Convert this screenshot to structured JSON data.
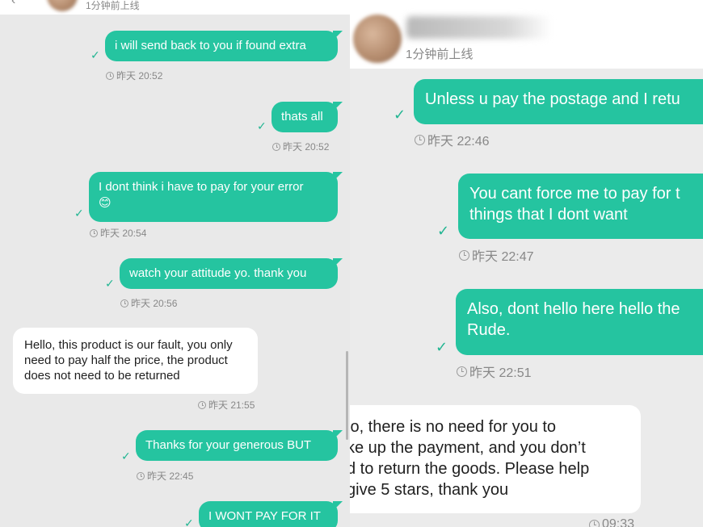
{
  "left_chat": {
    "contact_status": "1分钟前上线",
    "messages": [
      {
        "direction": "out",
        "text": "i will send back to you if found extra",
        "time": "昨天 20:52"
      },
      {
        "direction": "out",
        "text": "thats all",
        "time": "昨天 20:52"
      },
      {
        "direction": "out",
        "text": "I dont think i have to pay for your error",
        "emoji": "😊",
        "time": "昨天 20:54"
      },
      {
        "direction": "out",
        "text": "watch your attitude yo. thank you",
        "time": "昨天 20:56"
      },
      {
        "direction": "in",
        "text": "Hello, this product is our fault, you only need to pay half the price, the product does not need to be returned",
        "time": "昨天 21:55"
      },
      {
        "direction": "out",
        "text": "Thanks for your generous BUT",
        "time": "昨天 22:45"
      },
      {
        "direction": "out",
        "text": "I WONT PAY FOR IT",
        "time": ""
      }
    ]
  },
  "right_chat": {
    "contact_status": "1分钟前上线",
    "messages": [
      {
        "direction": "out",
        "text": "Unless u pay the postage and I retu",
        "time": "昨天 22:46"
      },
      {
        "direction": "out",
        "text": "You cant force me to pay for t\nthings that I dont want",
        "time": "昨天 22:47"
      },
      {
        "direction": "out",
        "text": "Also, dont hello here hello the\nRude.",
        "time": "昨天 22:51"
      },
      {
        "direction": "in",
        "text": "lo, there is no need for you to\nke up the payment, and you don’t\nd to return the goods. Please help\ngive 5 stars, thank you",
        "time": "09:33"
      }
    ]
  },
  "colors": {
    "outgoing_bubble": "#25c4a0",
    "incoming_bubble": "#ffffff",
    "check": "#22b592"
  },
  "icons": [
    "read-check-icon",
    "clock-icon",
    "avatar",
    "back-arrow-icon"
  ]
}
